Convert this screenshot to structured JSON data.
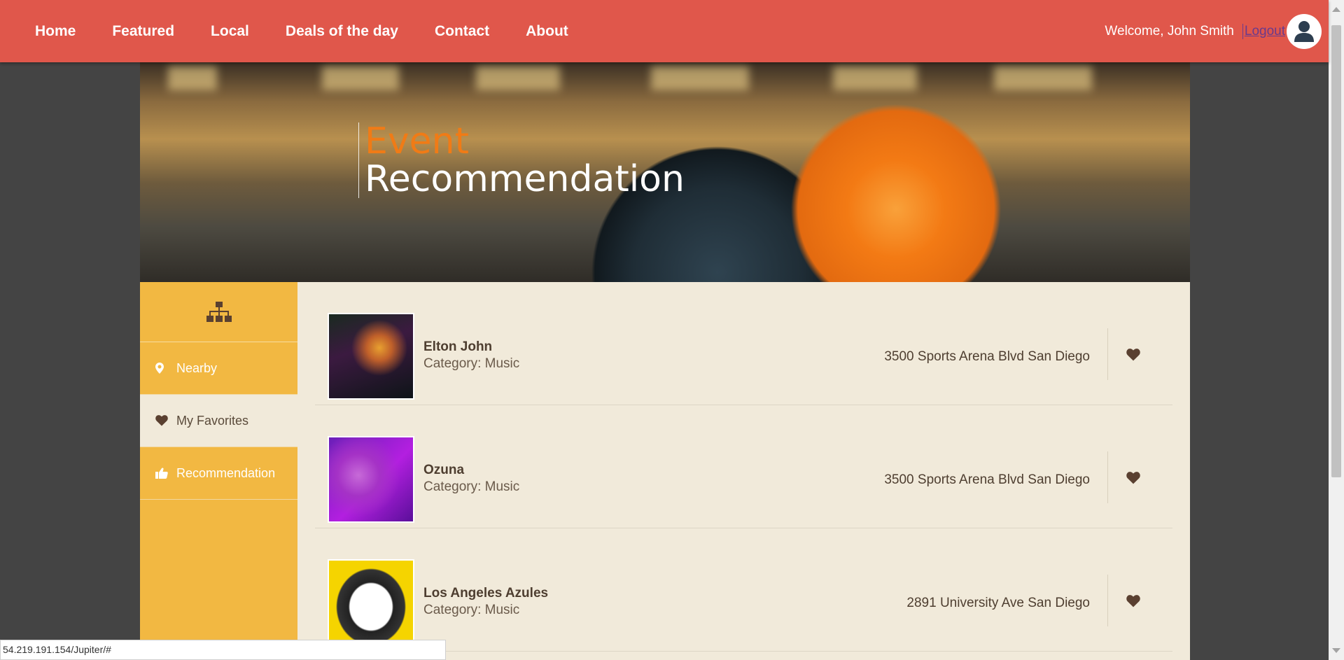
{
  "nav": {
    "links": [
      "Home",
      "Featured",
      "Local",
      "Deals of the day",
      "Contact",
      "About"
    ],
    "welcome": "Welcome, John Smith",
    "logout": "Logout"
  },
  "hero": {
    "line1": "Event",
    "line2": "Recommendation"
  },
  "sidebar": {
    "top_icon": "sitemap-icon",
    "items": [
      {
        "label": "Nearby",
        "icon": "map-marker-icon"
      },
      {
        "label": "My Favorites",
        "icon": "heart-icon",
        "active": true
      },
      {
        "label": "Recommendation",
        "icon": "thumbs-up-icon"
      }
    ]
  },
  "events": [
    {
      "name": "Elton John",
      "category": "Category: Music",
      "address": "3500 Sports Arena Blvd San Diego"
    },
    {
      "name": "Ozuna",
      "category": "Category: Music",
      "address": "3500 Sports Arena Blvd San Diego"
    },
    {
      "name": "Los Angeles Azules",
      "category": "Category: Music",
      "address": "2891 University Ave San Diego"
    }
  ],
  "status": {
    "url": "54.219.191.154/Jupiter/#"
  },
  "colors": {
    "nav_bg": "#e0574b",
    "sidebar_bg": "#f2b842",
    "content_bg": "#f1eada",
    "hero_accent": "#f07b16",
    "heart": "#5a4030"
  }
}
